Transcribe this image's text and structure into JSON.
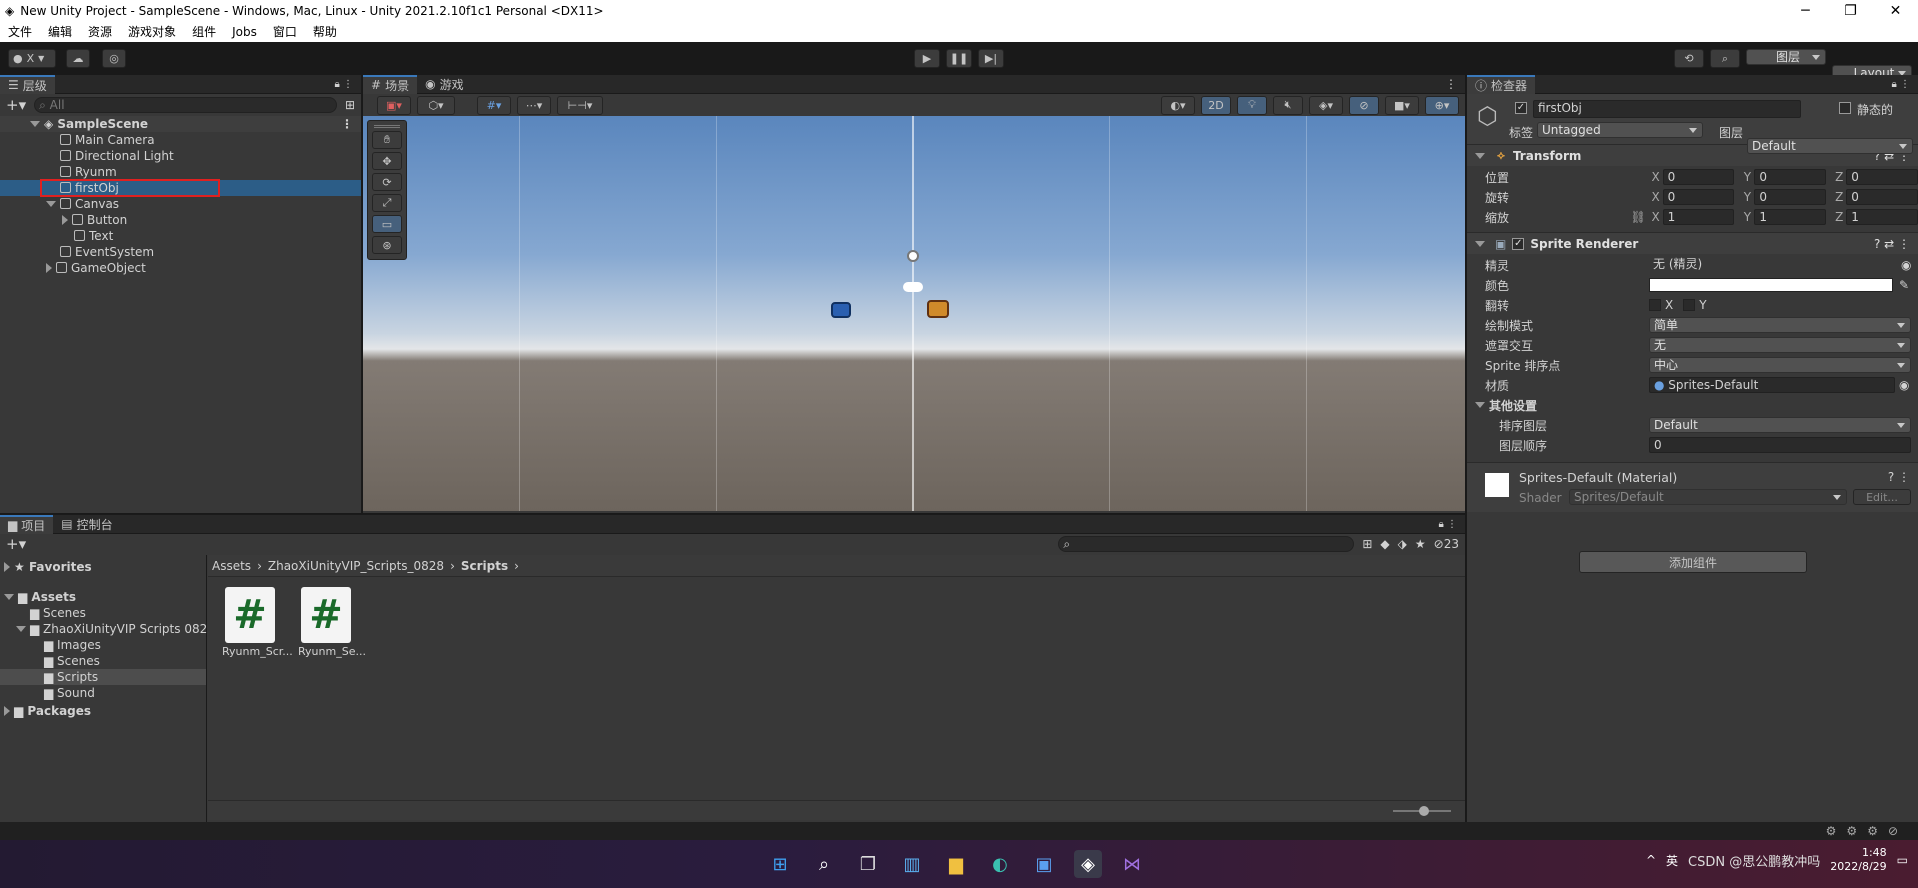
{
  "window": {
    "title": "New Unity Project - SampleScene - Windows, Mac, Linux - Unity 2021.2.10f1c1 Personal <DX11>",
    "minimize": "─",
    "maximize": "❐",
    "close": "✕"
  },
  "menu": [
    "文件",
    "编辑",
    "资源",
    "游戏对象",
    "组件",
    "Jobs",
    "窗口",
    "帮助"
  ],
  "toolbar": {
    "account": "X",
    "layers_label": "图层",
    "layout_label": "Layout"
  },
  "hierarchy": {
    "tab": "层级",
    "search_placeholder": "All",
    "scene": "SampleScene",
    "items": [
      {
        "label": "Main Camera"
      },
      {
        "label": "Directional Light"
      },
      {
        "label": "Ryunm"
      },
      {
        "label": "firstObj"
      },
      {
        "label": "Canvas"
      },
      {
        "label": "Button"
      },
      {
        "label": "Text"
      },
      {
        "label": "EventSystem"
      },
      {
        "label": "GameObject"
      }
    ]
  },
  "scene_view": {
    "tab_scene": "场景",
    "tab_game": "游戏",
    "btn_2d": "2D"
  },
  "inspector": {
    "tab": "检查器",
    "object_name": "firstObj",
    "static_label": "静态的",
    "tag_label": "标签",
    "tag_value": "Untagged",
    "layer_label": "图层",
    "layer_value": "Default",
    "transform": {
      "title": "Transform",
      "position_label": "位置",
      "rotation_label": "旋转",
      "scale_label": "缩放",
      "position": [
        "0",
        "0",
        "0"
      ],
      "rotation": [
        "0",
        "0",
        "0"
      ],
      "scale": [
        "1",
        "1",
        "1"
      ]
    },
    "sprite_renderer": {
      "title": "Sprite Renderer",
      "sprite_label": "精灵",
      "sprite_value": "无 (精灵)",
      "color_label": "颜色",
      "flip_label": "翻转",
      "flip_x": "X",
      "flip_y": "Y",
      "draw_mode_label": "绘制模式",
      "draw_mode_value": "简单",
      "mask_label": "遮罩交互",
      "mask_value": "无",
      "sort_point_label": "Sprite 排序点",
      "sort_point_value": "中心",
      "material_label": "材质",
      "material_value": "Sprites-Default",
      "other_label": "其他设置",
      "sorting_layer_label": "排序图层",
      "sorting_layer_value": "Default",
      "order_label": "图层顺序",
      "order_value": "0"
    },
    "material": {
      "title": "Sprites-Default (Material)",
      "shader_label": "Shader",
      "shader_value": "Sprites/Default",
      "edit": "Edit..."
    },
    "add_component": "添加组件"
  },
  "project": {
    "tab_project": "项目",
    "tab_console": "控制台",
    "favorites": "Favorites",
    "assets": "Assets",
    "tree": [
      {
        "label": "Scenes"
      },
      {
        "label": "ZhaoXiUnityVIP Scripts 082"
      },
      {
        "label": "Images"
      },
      {
        "label": "Scenes"
      },
      {
        "label": "Scripts"
      },
      {
        "label": "Sound"
      }
    ],
    "packages": "Packages",
    "breadcrumb": [
      "Assets",
      "ZhaoXiUnityVIP_Scripts_0828",
      "Scripts"
    ],
    "hidden_count": "23",
    "files": [
      {
        "name": "Ryunm_Scr..."
      },
      {
        "name": "Ryunm_Se..."
      }
    ]
  },
  "taskbar": {
    "time": "1:48",
    "date": "2022/8/29",
    "ime": "英",
    "watermark": "CSDN @思公鹏教冲吗"
  }
}
